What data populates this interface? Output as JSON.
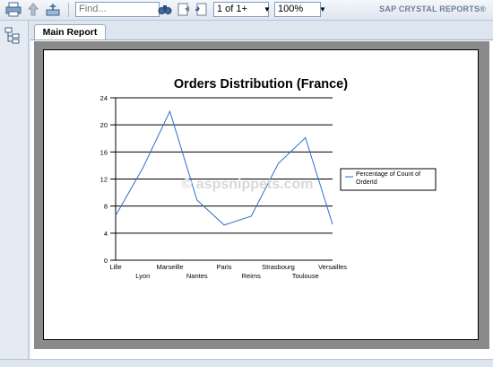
{
  "toolbar": {
    "find_placeholder": "Find...",
    "page_value": "1 of 1+",
    "zoom_value": "100%",
    "brand": "SAP CRYSTAL REPORTS®"
  },
  "tabs": [
    {
      "label": "Main Report"
    }
  ],
  "chart_data": {
    "type": "line",
    "title": "Orders Distribution (France)",
    "categories": [
      "Lille",
      "Lyon",
      "Marseille",
      "Nantes",
      "Paris",
      "Reims",
      "Strasbourg",
      "Toulouse",
      "Versailles"
    ],
    "series": [
      {
        "name": "Percentage of Count of OrderId",
        "values": [
          6.6,
          13.6,
          22.0,
          8.9,
          5.2,
          6.5,
          14.3,
          18.1,
          5.3
        ],
        "color": "#2f6dc8"
      }
    ],
    "ylim": [
      0,
      24
    ],
    "yticks": [
      0,
      4,
      8,
      12,
      16,
      20,
      24
    ],
    "grid": true,
    "legend_position": "right",
    "watermark": "© aspsnippets.com"
  }
}
